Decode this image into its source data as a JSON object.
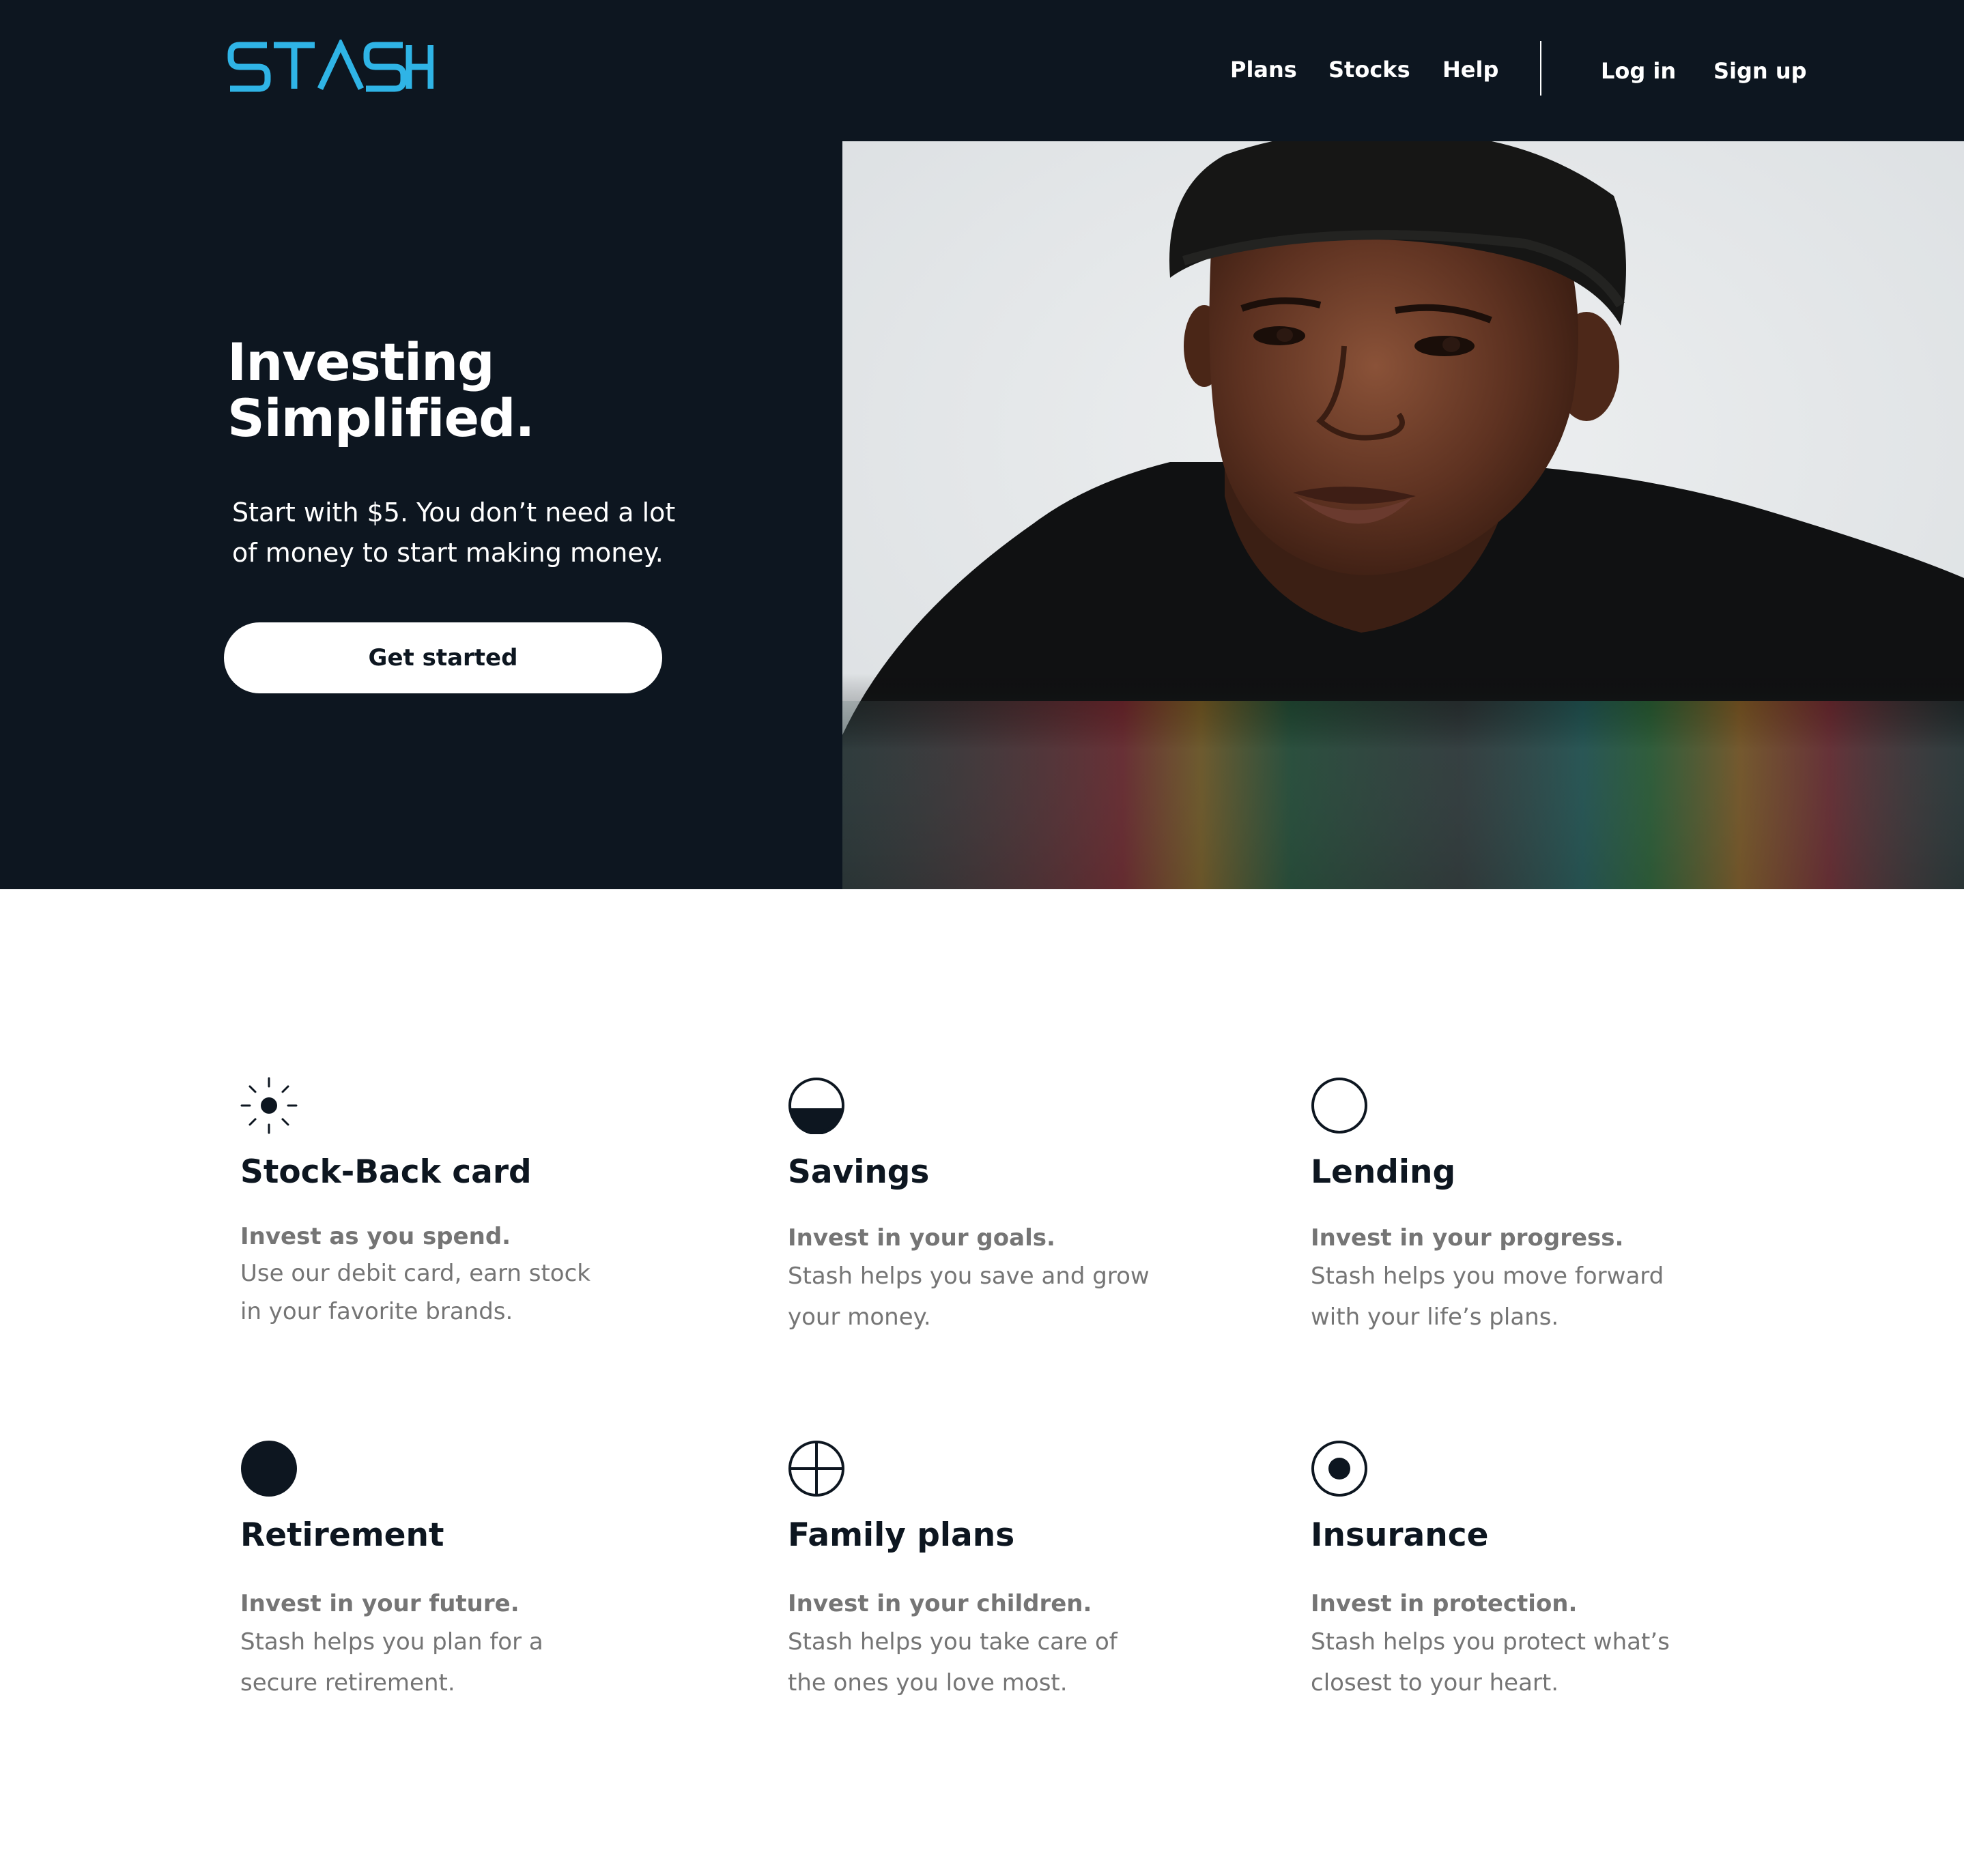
{
  "brand": {
    "logo_text": "STASH",
    "logo_color": "#2fb4e6"
  },
  "nav": {
    "plans": "Plans",
    "stocks": "Stocks",
    "help": "Help",
    "login": "Log in",
    "signup": "Sign up"
  },
  "hero": {
    "title_line1": "Investing",
    "title_line2": "Simplified.",
    "subtitle_line1": "Start with $5. You don’t need a lot",
    "subtitle_line2": "of money to start making money.",
    "cta_label": "Get started"
  },
  "features": [
    {
      "icon": "sun-icon",
      "title": "Stock-Back card",
      "subtitle": "Invest as you spend.",
      "desc_line1": "Use our debit card, earn stock",
      "desc_line2": "in your favorite brands."
    },
    {
      "icon": "half-circle-icon",
      "title": "Savings",
      "subtitle": "Invest in your goals.",
      "desc_line1": "Stash helps you save and grow",
      "desc_line2": "your money."
    },
    {
      "icon": "circle-outline-icon",
      "title": "Lending",
      "subtitle": "Invest in your progress.",
      "desc_line1": "Stash helps you move forward",
      "desc_line2": "with your life’s plans."
    },
    {
      "icon": "filled-circle-icon",
      "title": "Retirement",
      "subtitle": "Invest in your future.",
      "desc_line1": "Stash helps you plan for a",
      "desc_line2": "secure retirement."
    },
    {
      "icon": "crosshair-circle-icon",
      "title": "Family plans",
      "subtitle": "Invest in your children.",
      "desc_line1": "Stash helps you take care of",
      "desc_line2": "the ones you love most."
    },
    {
      "icon": "target-circle-icon",
      "title": "Insurance",
      "subtitle": "Invest in protection.",
      "desc_line1": "Stash helps you protect what’s",
      "desc_line2": "closest to your heart."
    }
  ],
  "colors": {
    "navy": "#0d1620",
    "accent": "#2fb4e6",
    "muted_text": "#757575",
    "white": "#ffffff"
  }
}
